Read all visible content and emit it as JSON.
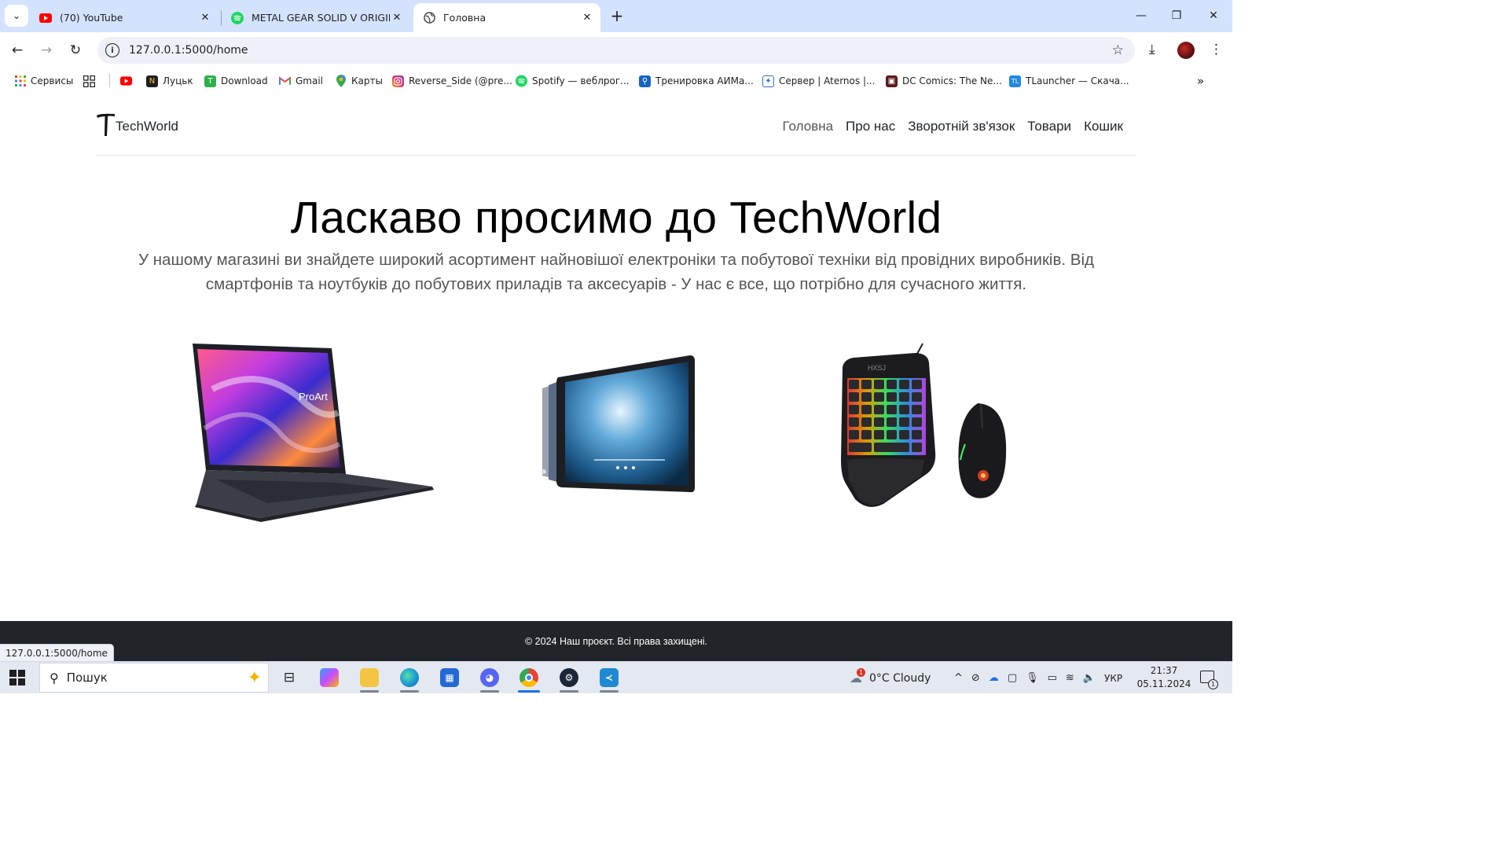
{
  "browser": {
    "tabs": [
      {
        "title": "(70) YouTube",
        "icon": "youtube-icon",
        "active": false
      },
      {
        "title": "METAL GEAR SOLID V ORIGINAL",
        "icon": "spotify-icon",
        "active": false
      },
      {
        "title": "Головна",
        "icon": "globe-icon",
        "active": true
      }
    ],
    "new_tab_label": "+",
    "url": "127.0.0.1:5000/home",
    "status_url": "127.0.0.1:5000/home"
  },
  "bookmarks": [
    {
      "label": "Сервисы",
      "icon": "apps-grid-icon"
    },
    {
      "label": "",
      "icon": "grid-icon"
    },
    {
      "label": "",
      "icon": "youtube-icon"
    },
    {
      "label": "Луцьк",
      "icon": "n-icon"
    },
    {
      "label": "Download",
      "icon": "tl-icon"
    },
    {
      "label": "Gmail",
      "icon": "gmail-icon"
    },
    {
      "label": "Карты",
      "icon": "maps-pin-icon"
    },
    {
      "label": "Reverse_Side (@pre...",
      "icon": "instagram-icon"
    },
    {
      "label": "Spotify — веблрог...",
      "icon": "spotify-icon"
    },
    {
      "label": "Тренировка АИМа...",
      "icon": "aim-icon"
    },
    {
      "label": "Сервер | Aternos |...",
      "icon": "aternos-icon"
    },
    {
      "label": "DC Comics: The Ne...",
      "icon": "dc-icon"
    },
    {
      "label": "TLauncher — Скача...",
      "icon": "tlauncher-icon"
    }
  ],
  "site": {
    "brand": "TechWorld",
    "nav": [
      {
        "label": "Головна",
        "current": true
      },
      {
        "label": "Про нас",
        "current": false
      },
      {
        "label": "Зворотній зв'язок",
        "current": false
      },
      {
        "label": "Товари",
        "current": false
      },
      {
        "label": "Кошик",
        "current": false
      }
    ],
    "hero_title": "Ласкаво просимо до TechWorld",
    "hero_lead": "У нашому магазині ви знайдете широкий асортимент найновішої електроніки та побутової техніки від провідних виробників. Від смартфонів та ноутбуків до побутових приладів та аксесуарів - У нас є все, що потрібно для сучасного життя.",
    "products": [
      {
        "name": "laptop-image",
        "screen_label": "ProArt"
      },
      {
        "name": "tablet-image"
      },
      {
        "name": "gaming-keyboard-mouse-image",
        "keyboard_label": "HXSJ"
      }
    ],
    "footer": "© 2024 Наш проєкт. Всі права захищені."
  },
  "taskbar": {
    "search_label": "Пошук",
    "weather": "0°C  Cloudy",
    "weather_badge": "1",
    "language": "УКР",
    "time": "21:37",
    "date": "05.11.2024",
    "notification_count": "1"
  },
  "colors": {
    "tabstrip": "#d3e3fd",
    "footer": "#212529",
    "accent": "#1a73e8"
  }
}
